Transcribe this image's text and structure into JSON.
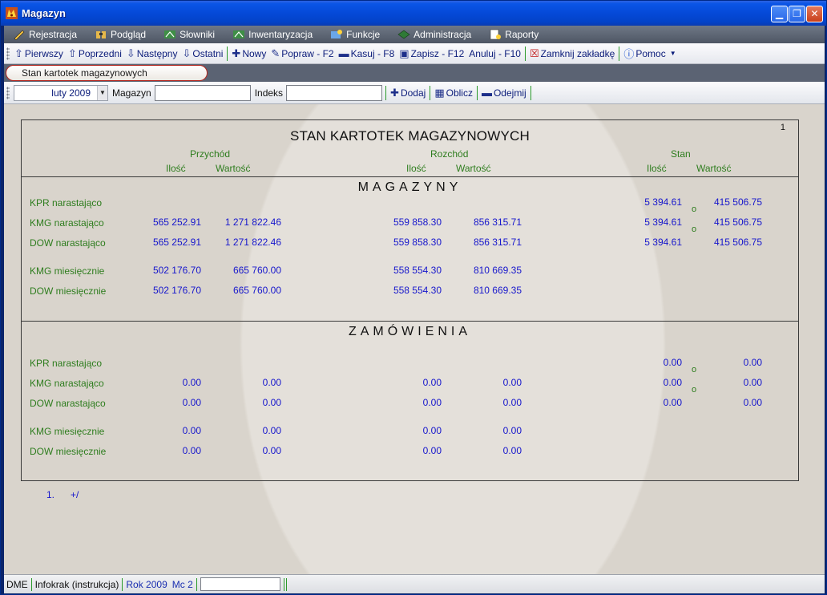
{
  "window": {
    "title": "Magazyn"
  },
  "menu": [
    "Rejestracja",
    "Podgląd",
    "Słowniki",
    "Inwentaryzacja",
    "Funkcje",
    "Administracja",
    "Raporty"
  ],
  "toolbar": {
    "first": "Pierwszy",
    "prev": "Poprzedni",
    "next": "Następny",
    "last": "Ostatni",
    "new": "Nowy",
    "edit": "Popraw - F2",
    "delete": "Kasuj - F8",
    "save": "Zapisz - F12",
    "cancel": "Anuluj - F10",
    "close_tab": "Zamknij zakładkę",
    "help": "Pomoc"
  },
  "tab": {
    "label": "Stan kartotek magazynowych"
  },
  "filter": {
    "month": "luty 2009",
    "magazyn_label": "Magazyn",
    "magazyn_value": "",
    "indeks_label": "Indeks",
    "indeks_value": "",
    "add": "Dodaj",
    "calc": "Oblicz",
    "subtract": "Odejmij"
  },
  "report": {
    "title": "STAN KARTOTEK MAGAZYNOWYCH",
    "page": "1",
    "groups": {
      "in": "Przychód",
      "out": "Rozchód",
      "stock": "Stan"
    },
    "qty": "Ilość",
    "value": "Wartość",
    "sections": {
      "magazyny": {
        "title": "MAGAZYNY",
        "rows": [
          {
            "label": "KPR narastająco",
            "in_q": "",
            "in_v": "",
            "out_q": "",
            "out_v": "",
            "st_q": "5 394.61",
            "st_v": "415 506.75"
          },
          {
            "label": "KMG narastająco",
            "in_q": "565 252.91",
            "in_v": "1 271 822.46",
            "out_q": "559 858.30",
            "out_v": "856 315.71",
            "st_q": "5 394.61",
            "st_v": "415 506.75"
          },
          {
            "label": "DOW narastająco",
            "in_q": "565 252.91",
            "in_v": "1 271 822.46",
            "out_q": "559 858.30",
            "out_v": "856 315.71",
            "st_q": "5 394.61",
            "st_v": "415 506.75"
          },
          {
            "label": "KMG miesięcznie",
            "in_q": "502 176.70",
            "in_v": "665 760.00",
            "out_q": "558 554.30",
            "out_v": "810 669.35",
            "st_q": "",
            "st_v": ""
          },
          {
            "label": "DOW miesięcznie",
            "in_q": "502 176.70",
            "in_v": "665 760.00",
            "out_q": "558 554.30",
            "out_v": "810 669.35",
            "st_q": "",
            "st_v": ""
          }
        ],
        "markers": [
          "o",
          "o"
        ]
      },
      "zamowienia": {
        "title": "ZAMÓWIENIA",
        "rows": [
          {
            "label": "KPR narastająco",
            "in_q": "",
            "in_v": "",
            "out_q": "",
            "out_v": "",
            "st_q": "0.00",
            "st_v": "0.00"
          },
          {
            "label": "KMG narastająco",
            "in_q": "0.00",
            "in_v": "0.00",
            "out_q": "0.00",
            "out_v": "0.00",
            "st_q": "0.00",
            "st_v": "0.00"
          },
          {
            "label": "DOW narastająco",
            "in_q": "0.00",
            "in_v": "0.00",
            "out_q": "0.00",
            "out_v": "0.00",
            "st_q": "0.00",
            "st_v": "0.00"
          },
          {
            "label": "KMG miesięcznie",
            "in_q": "0.00",
            "in_v": "0.00",
            "out_q": "0.00",
            "out_v": "0.00",
            "st_q": "",
            "st_v": ""
          },
          {
            "label": "DOW miesięcznie",
            "in_q": "0.00",
            "in_v": "0.00",
            "out_q": "0.00",
            "out_v": "0.00",
            "st_q": "",
            "st_v": ""
          }
        ],
        "markers": [
          "o",
          "o"
        ]
      }
    },
    "footer": {
      "num": "1.",
      "sign": "+/"
    }
  },
  "status": {
    "db": "DME",
    "user": "Infokrak (instrukcja)",
    "year": "Rok 2009",
    "month": "Mc 2"
  },
  "colors": {
    "label_green": "#2e7d1e",
    "value_blue": "#1616cc",
    "menubar": "#5b6373",
    "tab_border": "#b5271f"
  }
}
